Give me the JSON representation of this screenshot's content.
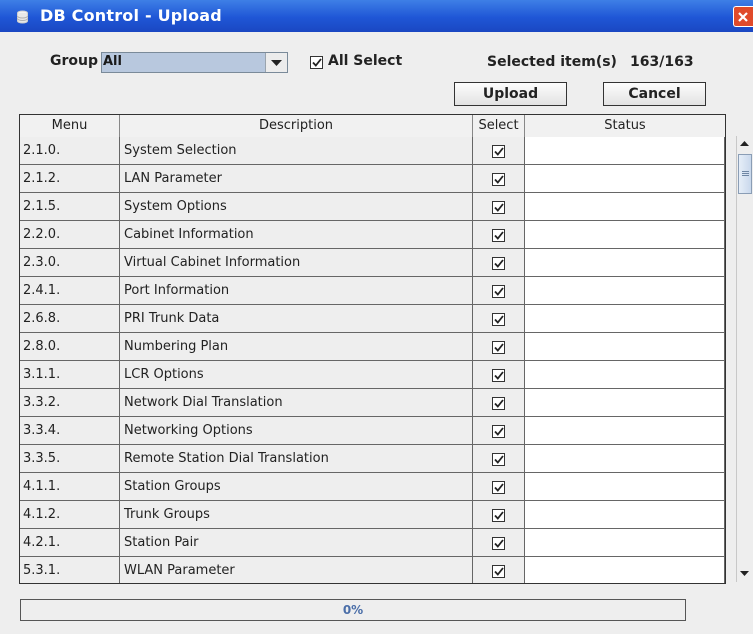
{
  "window": {
    "title": "DB Control - Upload"
  },
  "toolbar": {
    "group_label": "Group",
    "group_value": "All",
    "all_select_label": "All Select",
    "all_select_checked": true,
    "selected_label": "Selected item(s)",
    "selected_count": "163/163",
    "upload_label": "Upload",
    "cancel_label": "Cancel"
  },
  "table": {
    "columns": [
      "Menu",
      "Description",
      "Select",
      "Status"
    ],
    "rows": [
      {
        "menu": "2.1.0.",
        "description": "System Selection",
        "selected": true,
        "status": ""
      },
      {
        "menu": "2.1.2.",
        "description": "LAN Parameter",
        "selected": true,
        "status": ""
      },
      {
        "menu": "2.1.5.",
        "description": "System Options",
        "selected": true,
        "status": ""
      },
      {
        "menu": "2.2.0.",
        "description": "Cabinet Information",
        "selected": true,
        "status": ""
      },
      {
        "menu": "2.3.0.",
        "description": "Virtual Cabinet Information",
        "selected": true,
        "status": ""
      },
      {
        "menu": "2.4.1.",
        "description": "Port Information",
        "selected": true,
        "status": ""
      },
      {
        "menu": "2.6.8.",
        "description": "PRI Trunk Data",
        "selected": true,
        "status": ""
      },
      {
        "menu": "2.8.0.",
        "description": "Numbering Plan",
        "selected": true,
        "status": ""
      },
      {
        "menu": "3.1.1.",
        "description": "LCR Options",
        "selected": true,
        "status": ""
      },
      {
        "menu": "3.3.2.",
        "description": "Network Dial Translation",
        "selected": true,
        "status": ""
      },
      {
        "menu": "3.3.4.",
        "description": "Networking Options",
        "selected": true,
        "status": ""
      },
      {
        "menu": "3.3.5.",
        "description": "Remote Station Dial Translation",
        "selected": true,
        "status": ""
      },
      {
        "menu": "4.1.1.",
        "description": "Station Groups",
        "selected": true,
        "status": ""
      },
      {
        "menu": "4.1.2.",
        "description": "Trunk Groups",
        "selected": true,
        "status": ""
      },
      {
        "menu": "4.2.1.",
        "description": "Station Pair",
        "selected": true,
        "status": ""
      },
      {
        "menu": "5.3.1.",
        "description": "WLAN Parameter",
        "selected": true,
        "status": ""
      }
    ]
  },
  "progress": {
    "value": 0,
    "label": "0%"
  },
  "colors": {
    "titlebar": "#1f56d6",
    "close_button": "#e04a2a",
    "combo_selection": "#b8c8de",
    "progress_text": "#4a6ea8"
  }
}
